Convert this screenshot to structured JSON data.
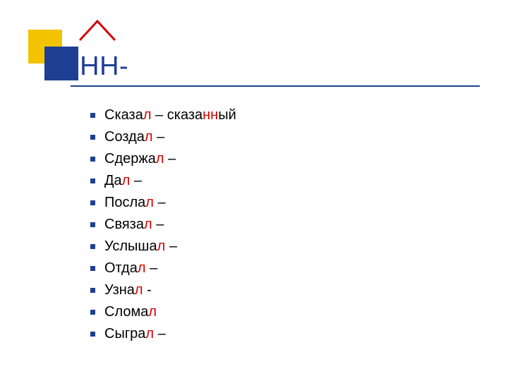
{
  "title": "-НН-",
  "colors": {
    "accent_blue": "#1f3f94",
    "accent_yellow": "#f3c300",
    "highlight_red": "#d30000"
  },
  "items": [
    {
      "stem": "Сказа",
      "stem_red": "л",
      "dash": " – ",
      "tail_black": "сказа",
      "tail_red": "нн",
      "tail_suffix": "ый"
    },
    {
      "stem": "Созда",
      "stem_red": "л",
      "dash": " –",
      "tail_black": "",
      "tail_red": "",
      "tail_suffix": ""
    },
    {
      "stem": "Сдержа",
      "stem_red": "л",
      "dash": " –",
      "tail_black": "",
      "tail_red": "",
      "tail_suffix": ""
    },
    {
      "stem": "Да",
      "stem_red": "л",
      "dash": " –",
      "tail_black": "",
      "tail_red": "",
      "tail_suffix": ""
    },
    {
      "stem": "Посла",
      "stem_red": "л",
      "dash": " –",
      "tail_black": "",
      "tail_red": "",
      "tail_suffix": ""
    },
    {
      "stem": "Связа",
      "stem_red": "л",
      "dash": " –",
      "tail_black": "",
      "tail_red": "",
      "tail_suffix": ""
    },
    {
      "stem": "Услыша",
      "stem_red": "л",
      "dash": " –",
      "tail_black": "",
      "tail_red": "",
      "tail_suffix": ""
    },
    {
      "stem": "Отда",
      "stem_red": "л",
      "dash": " –",
      "tail_black": "",
      "tail_red": "",
      "tail_suffix": ""
    },
    {
      "stem": "Узна",
      "stem_red": "л",
      "dash": " -",
      "tail_black": "",
      "tail_red": "",
      "tail_suffix": ""
    },
    {
      "stem": "Слома",
      "stem_red": "л",
      "dash": "",
      "tail_black": "",
      "tail_red": "",
      "tail_suffix": ""
    },
    {
      "stem": "Сыгра",
      "stem_red": "л",
      "dash": " –",
      "tail_black": "",
      "tail_red": "",
      "tail_suffix": ""
    }
  ]
}
